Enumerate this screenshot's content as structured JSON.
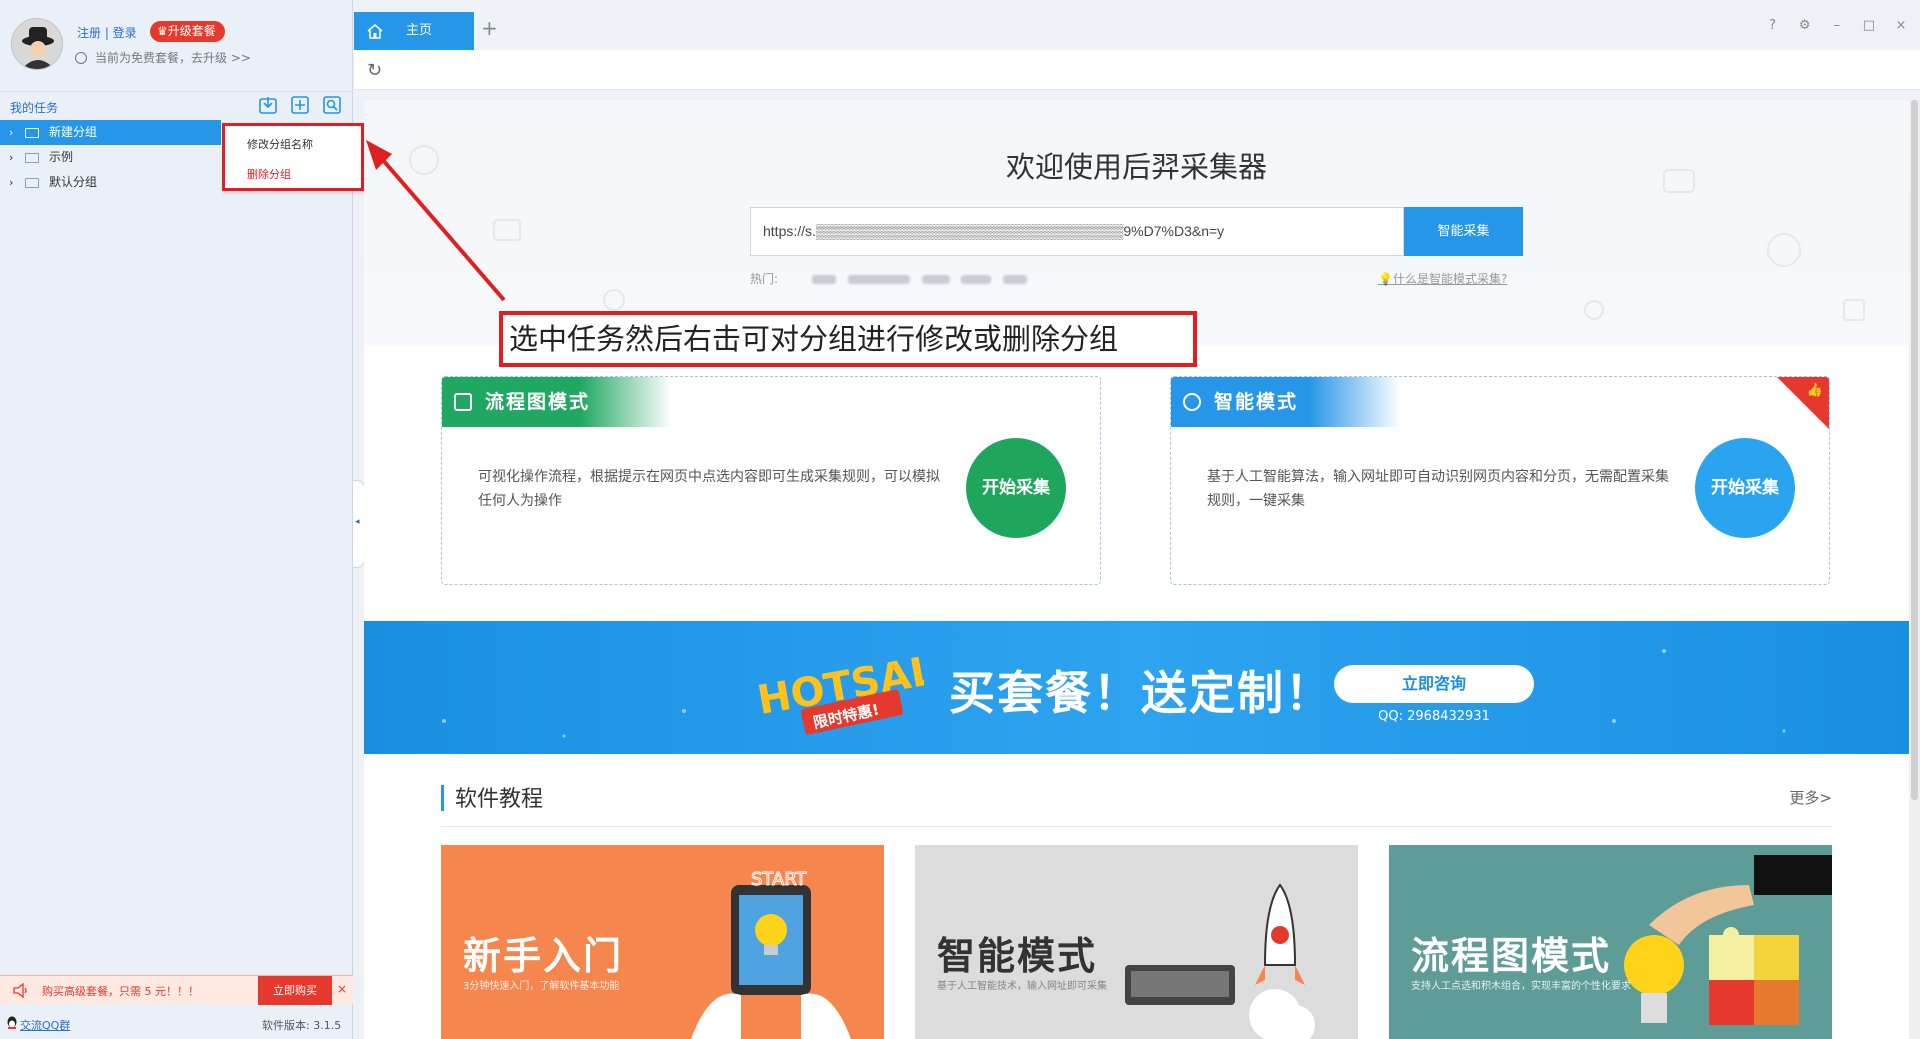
{
  "sidebar": {
    "auth_links": "注册 | 登录",
    "upgrade_badge": "♛升级套餐",
    "plan_text": "当前为免费套餐，去升级 >>",
    "tasks_title": "我的任务",
    "toolbar_icons": [
      "import-icon",
      "add-icon",
      "search-icon"
    ],
    "tree": [
      {
        "label": "新建分组",
        "selected": true
      },
      {
        "label": "示例",
        "selected": false
      },
      {
        "label": "默认分组",
        "selected": false
      }
    ],
    "context_menu": {
      "rename": "修改分组名称",
      "delete": "删除分组"
    },
    "promo_text": "购买高级套餐，只需 5 元！！！",
    "buy_now": "立即购买",
    "promo_close": "×",
    "qq_link": "交流QQ群",
    "version": "软件版本: 3.1.5"
  },
  "tabs": {
    "home": "主页",
    "add": "+"
  },
  "window_controls": [
    "help-icon",
    "settings-icon",
    "minimize-icon",
    "maximize-icon",
    "close-icon"
  ],
  "main": {
    "welcome_title": "欢迎使用后羿采集器",
    "url_value": "https://s.▒▒▒▒▒▒▒▒▒▒▒▒▒▒▒▒▒▒▒▒▒▒▒▒▒▒▒▒▒▒▒9%D7%D3&n=y",
    "smart_button": "智能采集",
    "hot_label": "热门:",
    "what_smart": "什么是智能模式采集?",
    "annotation": "选中任务然后右击可对分组进行修改或删除分组",
    "flow_mode": {
      "title": "流程图模式",
      "desc": "可视化操作流程，根据提示在网页中点选内容即可生成采集规则，可以模拟任何人为操作",
      "start": "开始采集"
    },
    "smart_mode": {
      "title": "智能模式",
      "desc": "基于人工智能算法，输入网址即可自动识别网页内容和分页，无需配置采集规则，一键采集",
      "start": "开始采集"
    },
    "banner": {
      "title": "买套餐！送定制！",
      "consult": "立即咨询",
      "qq": "QQ: 2968432931",
      "logo_text": "HOTSALE",
      "logo_sub": "限时特惠!"
    },
    "tutorials": {
      "title": "软件教程",
      "more": "更多>",
      "cards": [
        {
          "title": "新手入门",
          "sub": "3分钟快速入门，了解软件基本功能"
        },
        {
          "title": "智能模式",
          "sub": "基于人工智能技术，输入网址即可采集"
        },
        {
          "title": "流程图模式",
          "sub": "支持人工点选和积木组合，实现丰富的个性化要求"
        }
      ]
    }
  },
  "colors": {
    "accent_blue": "#2596e8",
    "green": "#1ea65c",
    "red": "#e5392e",
    "orange": "#f5874e",
    "teal": "#5e9c97"
  }
}
